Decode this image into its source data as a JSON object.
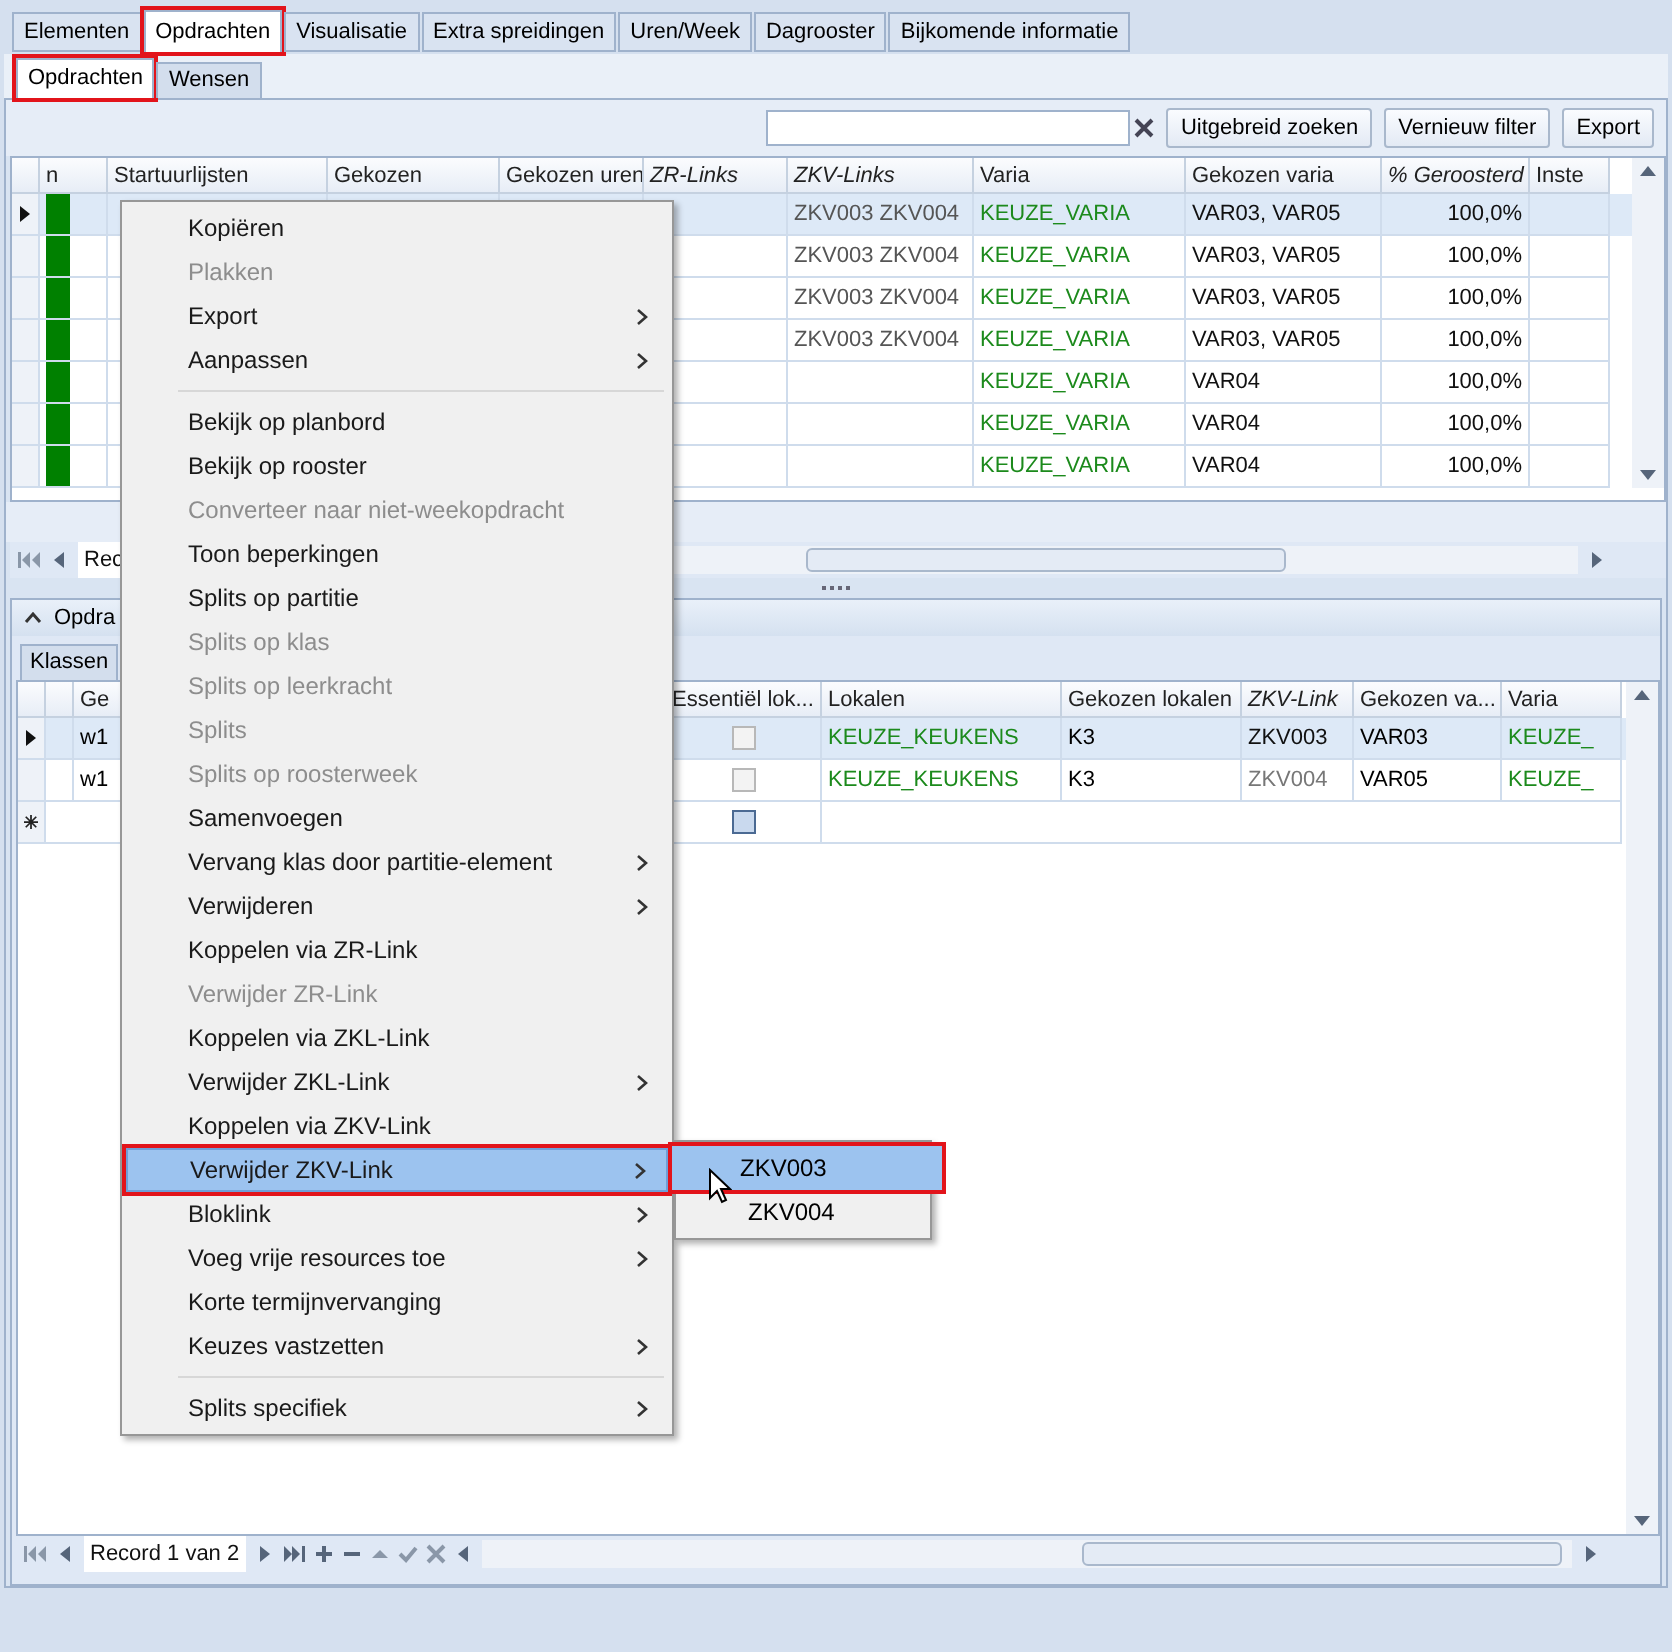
{
  "tabs": [
    {
      "label": "Elementen",
      "selected": false,
      "annotated": false
    },
    {
      "label": "Opdrachten",
      "selected": true,
      "annotated": true
    },
    {
      "label": "Visualisatie",
      "selected": false,
      "annotated": false
    },
    {
      "label": "Extra spreidingen",
      "selected": false,
      "annotated": false
    },
    {
      "label": "Uren/Week",
      "selected": false,
      "annotated": false
    },
    {
      "label": "Dagrooster",
      "selected": false,
      "annotated": false
    },
    {
      "label": "Bijkomende informatie",
      "selected": false,
      "annotated": false
    }
  ],
  "subtabs": [
    {
      "label": "Opdrachten",
      "selected": true,
      "annotated": true
    },
    {
      "label": "Wensen",
      "selected": false,
      "annotated": false
    }
  ],
  "toolbar": {
    "buttons": [
      "Uitgebreid zoeken",
      "Vernieuw filter",
      "Export"
    ]
  },
  "top_grid": {
    "columns": [
      {
        "label": "n",
        "italic": false
      },
      {
        "label": "Startuurlijsten",
        "italic": false
      },
      {
        "label": "Gekozen",
        "italic": false
      },
      {
        "label": "Gekozen uren",
        "italic": false
      },
      {
        "label": "ZR-Links",
        "italic": true
      },
      {
        "label": "ZKV-Links",
        "italic": true
      },
      {
        "label": "Varia",
        "italic": false
      },
      {
        "label": "Gekozen varia",
        "italic": false
      },
      {
        "label": "% Geroosterd",
        "italic": true
      },
      {
        "label": "Inste",
        "italic": false
      }
    ],
    "rows": [
      {
        "selected": true,
        "color": "#008000",
        "zkv_links": "ZKV003 ZKV004",
        "varia": "KEUZE_VARIA",
        "gekozen_varia": "VAR03,  VAR05",
        "geroosterd": "100,0%"
      },
      {
        "selected": false,
        "color": "#008000",
        "zkv_links": "ZKV003 ZKV004",
        "varia": "KEUZE_VARIA",
        "gekozen_varia": "VAR03,  VAR05",
        "geroosterd": "100,0%"
      },
      {
        "selected": false,
        "color": "#008000",
        "zkv_links": "ZKV003 ZKV004",
        "varia": "KEUZE_VARIA",
        "gekozen_varia": "VAR03,  VAR05",
        "geroosterd": "100,0%"
      },
      {
        "selected": false,
        "color": "#008000",
        "zkv_links": "ZKV003 ZKV004",
        "varia": "KEUZE_VARIA",
        "gekozen_varia": "VAR03,  VAR05",
        "geroosterd": "100,0%"
      },
      {
        "selected": false,
        "color": "#008000",
        "varia": "KEUZE_VARIA",
        "gekozen_varia": "VAR04",
        "geroosterd": "100,0%"
      },
      {
        "selected": false,
        "color": "#008000",
        "varia": "KEUZE_VARIA",
        "gekozen_varia": "VAR04",
        "geroosterd": "100,0%"
      },
      {
        "selected": false,
        "color": "#008000",
        "varia": "KEUZE_VARIA",
        "gekozen_varia": "VAR04",
        "geroosterd": "100,0%"
      }
    ],
    "navigator": "Rec"
  },
  "group": {
    "title": "Opdra",
    "tab": "Klassen"
  },
  "bottom_grid": {
    "columns": [
      {
        "label": "Ge",
        "italic": false
      },
      {
        "label": "Essentiël lok...",
        "italic": false
      },
      {
        "label": "Lokalen",
        "italic": false
      },
      {
        "label": "Gekozen lokalen",
        "italic": false
      },
      {
        "label": "ZKV-Link",
        "italic": true
      },
      {
        "label": "Gekozen va...",
        "italic": false
      },
      {
        "label": "Varia",
        "italic": false
      }
    ],
    "rows": [
      {
        "selected": true,
        "ge": "w1",
        "essential_checked": false,
        "lokalen": "KEUZE_KEUKENS",
        "gekozen_lokalen": "K3",
        "zkv_link": "ZKV003",
        "zkv_dimmed": false,
        "gekozen_varia": "VAR03",
        "varia": "KEUZE_"
      },
      {
        "selected": false,
        "ge": "w1",
        "essential_checked": false,
        "lokalen": "KEUZE_KEUKENS",
        "gekozen_lokalen": "K3",
        "zkv_link": "ZKV004",
        "zkv_dimmed": true,
        "gekozen_varia": "VAR05",
        "varia": "KEUZE_"
      }
    ],
    "new_row": {
      "essential_checked": false
    },
    "navigator": "Record 1 van 2"
  },
  "context_menu": [
    {
      "kind": "item",
      "label": "Kopiëren",
      "disabled": false,
      "submenu": false,
      "selected": false
    },
    {
      "kind": "item",
      "label": "Plakken",
      "disabled": true,
      "submenu": false,
      "selected": false
    },
    {
      "kind": "item",
      "label": "Export",
      "disabled": false,
      "submenu": true,
      "selected": false
    },
    {
      "kind": "item",
      "label": "Aanpassen",
      "disabled": false,
      "submenu": true,
      "selected": false
    },
    {
      "kind": "separator"
    },
    {
      "kind": "item",
      "label": "Bekijk op planbord",
      "disabled": false,
      "submenu": false,
      "selected": false
    },
    {
      "kind": "item",
      "label": "Bekijk op rooster",
      "disabled": false,
      "submenu": false,
      "selected": false
    },
    {
      "kind": "item",
      "label": "Converteer naar niet-weekopdracht",
      "disabled": true,
      "submenu": false,
      "selected": false
    },
    {
      "kind": "item",
      "label": "Toon beperkingen",
      "disabled": false,
      "submenu": false,
      "selected": false
    },
    {
      "kind": "item",
      "label": "Splits op partitie",
      "disabled": false,
      "submenu": false,
      "selected": false
    },
    {
      "kind": "item",
      "label": "Splits op klas",
      "disabled": true,
      "submenu": false,
      "selected": false
    },
    {
      "kind": "item",
      "label": "Splits op leerkracht",
      "disabled": true,
      "submenu": false,
      "selected": false
    },
    {
      "kind": "item",
      "label": "Splits",
      "disabled": true,
      "submenu": false,
      "selected": false
    },
    {
      "kind": "item",
      "label": "Splits op roosterweek",
      "disabled": true,
      "submenu": false,
      "selected": false
    },
    {
      "kind": "item",
      "label": "Samenvoegen",
      "disabled": false,
      "submenu": false,
      "selected": false
    },
    {
      "kind": "item",
      "label": "Vervang klas door partitie-element",
      "disabled": false,
      "submenu": true,
      "selected": false
    },
    {
      "kind": "item",
      "label": "Verwijderen",
      "disabled": false,
      "submenu": true,
      "selected": false
    },
    {
      "kind": "item",
      "label": "Koppelen via ZR-Link",
      "disabled": false,
      "submenu": false,
      "selected": false
    },
    {
      "kind": "item",
      "label": "Verwijder ZR-Link",
      "disabled": true,
      "submenu": false,
      "selected": false
    },
    {
      "kind": "item",
      "label": "Koppelen via ZKL-Link",
      "disabled": false,
      "submenu": false,
      "selected": false
    },
    {
      "kind": "item",
      "label": "Verwijder ZKL-Link",
      "disabled": false,
      "submenu": true,
      "selected": false
    },
    {
      "kind": "item",
      "label": "Koppelen via ZKV-Link",
      "disabled": false,
      "submenu": false,
      "selected": false
    },
    {
      "kind": "item",
      "label": "Verwijder ZKV-Link",
      "disabled": false,
      "submenu": true,
      "selected": true,
      "annotated": true
    },
    {
      "kind": "item",
      "label": "Bloklink",
      "disabled": false,
      "submenu": true,
      "selected": false
    },
    {
      "kind": "item",
      "label": "Voeg vrije resources toe",
      "disabled": false,
      "submenu": true,
      "selected": false
    },
    {
      "kind": "item",
      "label": "Korte termijnvervanging",
      "disabled": false,
      "submenu": false,
      "selected": false
    },
    {
      "kind": "item",
      "label": "Keuzes vastzetten",
      "disabled": false,
      "submenu": true,
      "selected": false
    },
    {
      "kind": "separator"
    },
    {
      "kind": "item",
      "label": "Splits specifiek",
      "disabled": false,
      "submenu": true,
      "selected": false
    }
  ],
  "submenu": [
    {
      "label": "ZKV003",
      "selected": true,
      "annotated": true
    },
    {
      "label": "ZKV004",
      "selected": false,
      "annotated": false
    }
  ]
}
